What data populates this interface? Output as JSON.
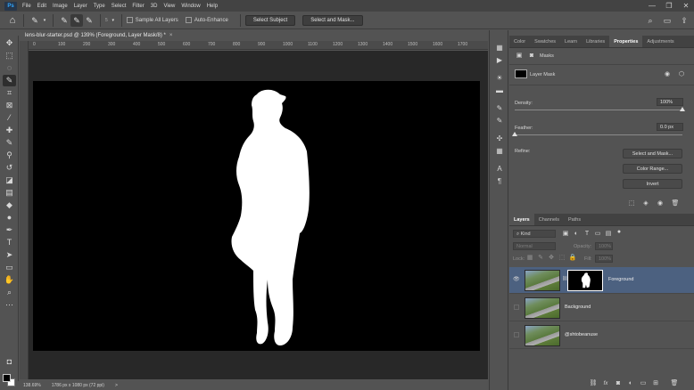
{
  "menubar": {
    "logo": "Ps",
    "items": [
      "File",
      "Edit",
      "Image",
      "Layer",
      "Type",
      "Select",
      "Filter",
      "3D",
      "View",
      "Window",
      "Help"
    ],
    "window_controls": [
      "—",
      "❐",
      "✕"
    ]
  },
  "options_bar": {
    "brush_size": "5",
    "sample_all_layers_label": "Sample All Layers",
    "auto_enhance_label": "Auto-Enhance",
    "select_subject_label": "Select Subject",
    "select_and_mask_label": "Select and Mask..."
  },
  "document": {
    "tab_title": "lens-blur-starter.psd @ 139% (Foreground, Layer Mask/8) *",
    "close": "×",
    "ruler_ticks": [
      "0",
      "100",
      "200",
      "300",
      "400",
      "500",
      "600",
      "700",
      "800",
      "900",
      "1000",
      "1100",
      "1200",
      "1300",
      "1400",
      "1500",
      "1600",
      "1700"
    ]
  },
  "status": {
    "zoom": "138.69%",
    "doc_info": "1786 px x 1080 px (72 ppi)",
    "arrow": ">"
  },
  "properties_panel": {
    "tabs": [
      "Color",
      "Swatches",
      "Learn",
      "Libraries",
      "Properties",
      "Adjustments"
    ],
    "active_tab": "Properties",
    "masks_label": "Masks",
    "layer_mask_label": "Layer Mask",
    "density_label": "Density:",
    "density_value": "100%",
    "density_level": 1.0,
    "feather_label": "Feather:",
    "feather_value": "0.0 px",
    "feather_level": 0.0,
    "refine_label": "Refine:",
    "select_and_mask_button": "Select and Mask...",
    "color_range_button": "Color Range...",
    "invert_button": "Invert"
  },
  "layers_panel": {
    "tabs": [
      "Layers",
      "Channels",
      "Paths"
    ],
    "active_tab": "Layers",
    "kind_label": "Kind",
    "blend_mode": "Normal",
    "opacity_label": "Opacity:",
    "opacity_value": "100%",
    "lock_label": "Lock:",
    "fill_label": "Fill:",
    "fill_value": "100%",
    "layers": [
      {
        "name": "Foreground",
        "selected": true,
        "has_mask": true,
        "visible": true
      },
      {
        "name": "Background",
        "selected": false,
        "has_mask": false,
        "visible": false
      },
      {
        "name": "@shtobeanuse",
        "selected": false,
        "has_mask": false,
        "visible": false
      }
    ],
    "footer_icons": [
      "link-icon",
      "fx-icon",
      "mask-icon",
      "adjustment-icon",
      "group-icon",
      "new-layer-icon",
      "trash-icon"
    ]
  },
  "colors": {
    "selected_layer": "#4c6180",
    "canvas": "#000000",
    "mask_subject": "#ffffff"
  }
}
